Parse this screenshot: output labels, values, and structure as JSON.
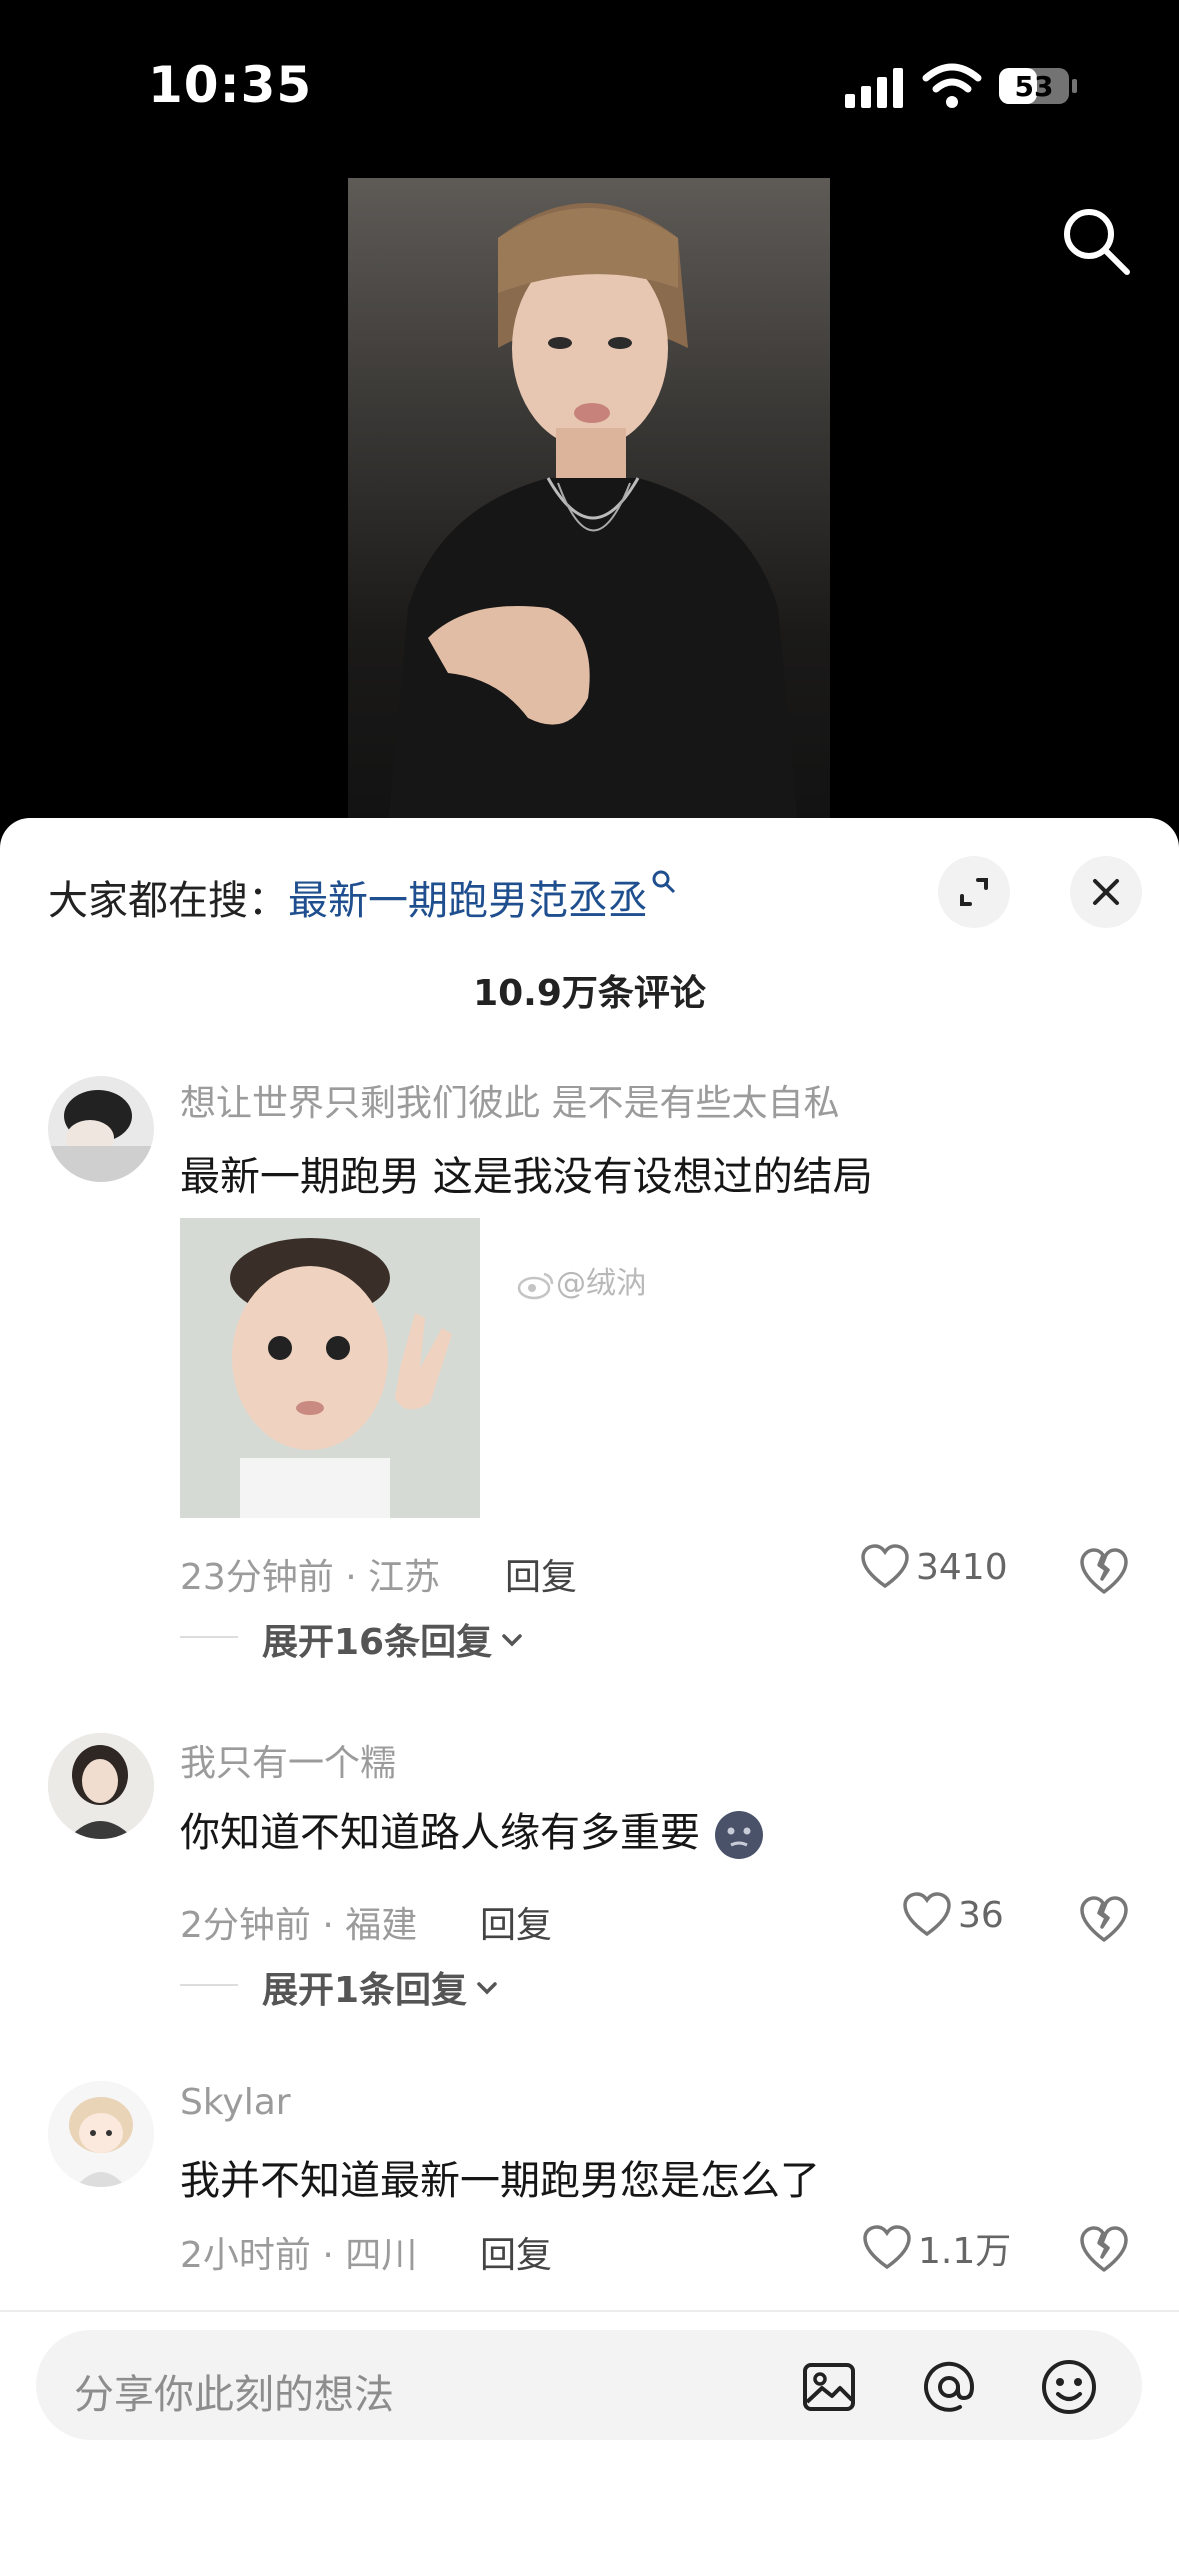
{
  "status_bar": {
    "time": "10:35",
    "battery": "53"
  },
  "search_bar": {
    "prefix": "大家都在搜：",
    "keyword": "最新一期跑男范丞丞"
  },
  "comments_count": "10.9万条评论",
  "comments": [
    {
      "username": "想让世界只剩我们彼此 是不是有些太自私",
      "text": "最新一期跑男 这是我没有设想过的结局",
      "image_watermark": "@绒汭",
      "meta": "23分钟前 · 江苏",
      "reply": "回复",
      "likes": "3410",
      "expand": "展开16条回复"
    },
    {
      "username": "我只有一个糯",
      "text": "你知道不知道路人缘有多重要",
      "meta": "2分钟前 · 福建",
      "reply": "回复",
      "likes": "36",
      "expand": "展开1条回复"
    },
    {
      "username": "Skylar",
      "text": "我并不知道最新一期跑男您是怎么了",
      "meta": "2小时前 · 四川",
      "reply": "回复",
      "likes": "1.1万"
    }
  ],
  "composer": {
    "placeholder": "分享你此刻的想法"
  },
  "colors": {
    "keyword": "#1f4f8f",
    "background": "#000000",
    "sheet": "#ffffff"
  }
}
